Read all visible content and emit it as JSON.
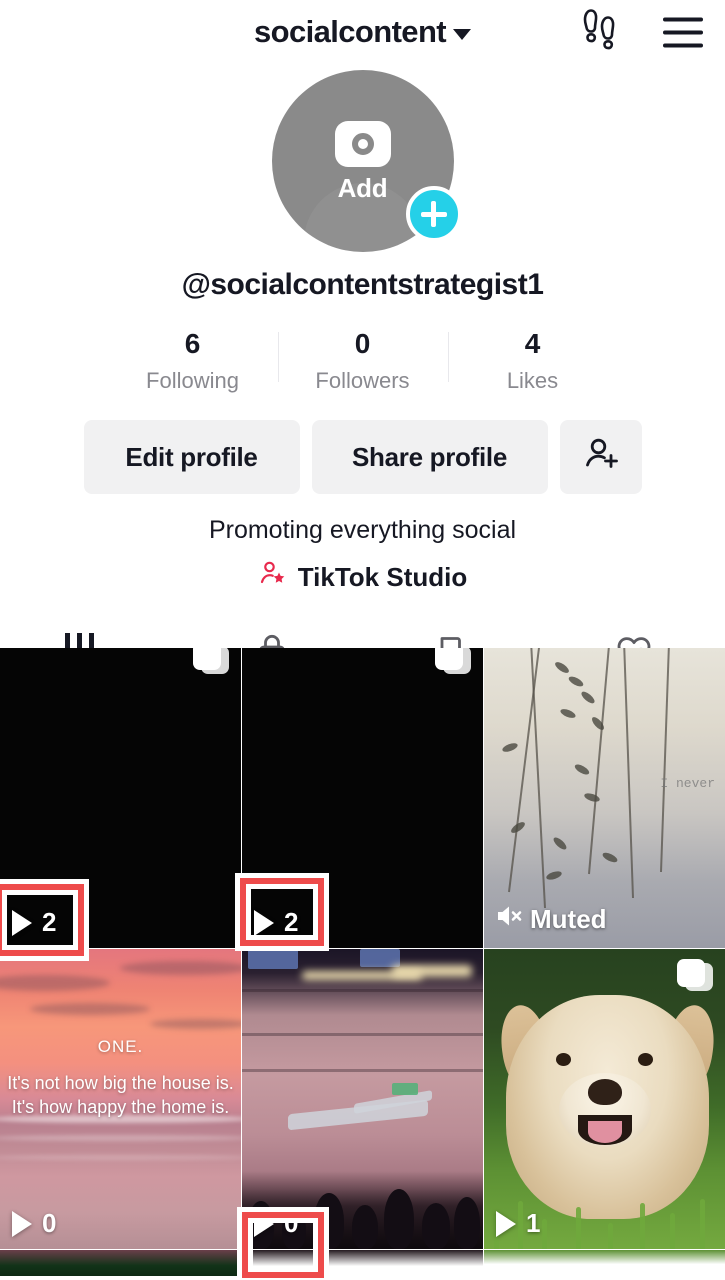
{
  "header": {
    "title": "socialcontent",
    "caret_icon": "chevron-down-icon",
    "footprints_icon": "footprints-icon",
    "menu_icon": "hamburger-menu-icon"
  },
  "profile": {
    "avatar": {
      "add_label": "Add",
      "camera_icon": "camera-icon",
      "plus_badge_icon": "plus-icon",
      "plus_badge_color": "#25d0e8",
      "placeholder_color": "#8a8a8a"
    },
    "username": "@socialcontentstrategist1",
    "stats": [
      {
        "value": "6",
        "label": "Following"
      },
      {
        "value": "0",
        "label": "Followers"
      },
      {
        "value": "4",
        "label": "Likes"
      }
    ],
    "actions": {
      "edit_label": "Edit profile",
      "share_label": "Share profile",
      "add_friends_icon": "add-person-icon"
    },
    "bio": "Promoting everything social",
    "studio_link": {
      "label": "TikTok Studio",
      "icon": "tiktok-studio-person-star-icon",
      "icon_color": "#e8294c"
    }
  },
  "tabs": [
    {
      "name": "posts",
      "icon": "grid-posts-icon",
      "active": true,
      "has_caret": true
    },
    {
      "name": "private",
      "icon": "lock-icon",
      "active": false,
      "has_caret": false
    },
    {
      "name": "reposts",
      "icon": "bookmark-hidden-icon",
      "active": false,
      "has_caret": false
    },
    {
      "name": "liked",
      "icon": "heart-hidden-icon",
      "active": false,
      "has_caret": false
    }
  ],
  "grid": {
    "videos": [
      {
        "id": 1,
        "thumb": "black",
        "views": "2",
        "carousel": true,
        "muted": false,
        "highlighted": true
      },
      {
        "id": 2,
        "thumb": "black",
        "views": "2",
        "carousel": true,
        "muted": false,
        "highlighted": true
      },
      {
        "id": 3,
        "thumb": "reeds",
        "views": "",
        "carousel": false,
        "muted": true,
        "muted_label": "Muted",
        "overlay_text": "I never",
        "highlighted": false
      },
      {
        "id": 4,
        "thumb": "sunset",
        "views": "0",
        "carousel": false,
        "muted": false,
        "highlighted": false,
        "caption_title": "ONE.",
        "caption_lines": [
          "It's not how big the house is.",
          "It's how happy the home is."
        ]
      },
      {
        "id": 5,
        "thumb": "concert",
        "views": "0",
        "carousel": false,
        "muted": false,
        "highlighted": true
      },
      {
        "id": 6,
        "thumb": "puppy",
        "views": "1",
        "carousel": true,
        "muted": false,
        "highlighted": false
      }
    ]
  },
  "annotations": {
    "color": "#ee4b4b",
    "boxes": [
      {
        "target": "views-video-1"
      },
      {
        "target": "views-video-2"
      },
      {
        "target": "views-video-5"
      }
    ]
  }
}
